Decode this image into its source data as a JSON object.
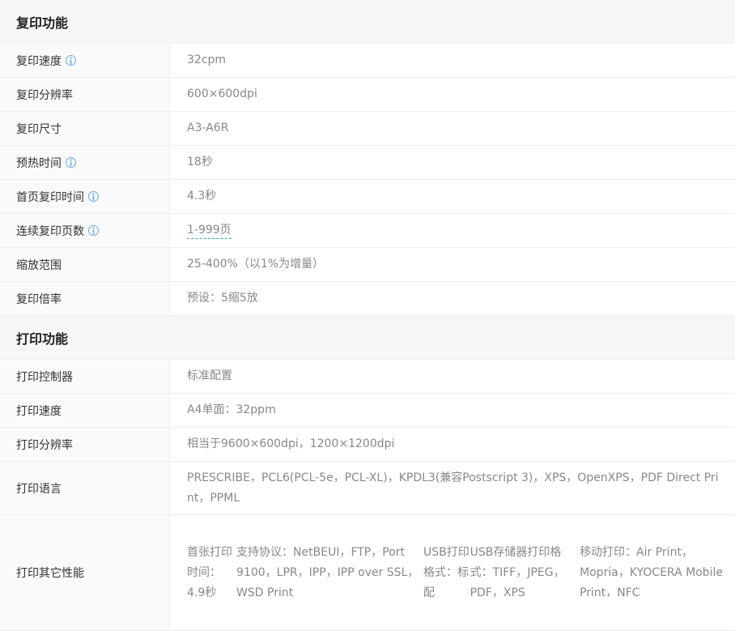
{
  "sections": [
    {
      "title": "复印功能",
      "rows": [
        {
          "label": "复印速度",
          "value": "32cpm",
          "info": true
        },
        {
          "label": "复印分辨率",
          "value": "600×600dpi"
        },
        {
          "label": "复印尺寸",
          "value": "A3-A6R"
        },
        {
          "label": "预热时间",
          "value": "18秒",
          "info": true
        },
        {
          "label": "首页复印时间",
          "value": "4.3秒",
          "info": true
        },
        {
          "label": "连续复印页数",
          "value": "1-999页",
          "info": true,
          "link": true
        },
        {
          "label": "缩放范围",
          "value": "25-400%（以1%为增量）"
        },
        {
          "label": "复印倍率",
          "value": "预设：5缩5放"
        }
      ]
    },
    {
      "title": "打印功能",
      "rows": [
        {
          "label": "打印控制器",
          "value": "标准配置"
        },
        {
          "label": "打印速度",
          "value": "A4单面：32ppm"
        },
        {
          "label": "打印分辨率",
          "value": "相当于9600×600dpi，1200×1200dpi"
        },
        {
          "label": "打印语言",
          "value": "PRESCRIBE，PCL6(PCL-5e，PCL-XL)，KPDL3(兼容Postscript 3)，XPS，OpenXPS，PDF Direct Print，PPML"
        },
        {
          "label": "打印其它性能",
          "lines": [
            "首张打印时间：4.9秒",
            "支持协议：NetBEUI，FTP，Port 9100，LPR，IPP，IPP over SSL，WSD Print",
            "USB打印格式：标配",
            "USB存储器打印格式：TIFF，JPEG，PDF，XPS",
            "移动打印：Air Print，Mopria，KYOCERA Mobile Print，NFC"
          ]
        }
      ]
    }
  ]
}
